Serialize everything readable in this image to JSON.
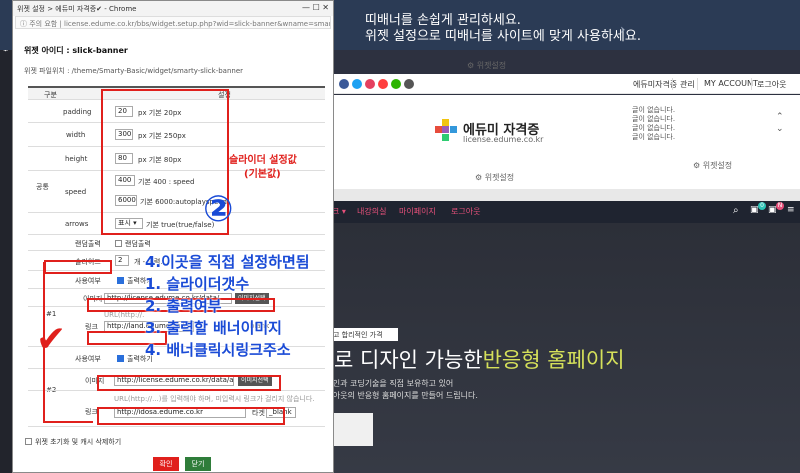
{
  "popup": {
    "window_title": "위젯 설정 > 에듀미 자격증✔ - Chrome",
    "address_warning": "주의 요함",
    "address_url": "license.edume.co.kr/bbs/widget.setup.php?wid=slick-banner&wname=smart...",
    "widget_id": "위젯 아이디 : slick-banner",
    "widget_path": "위젯 파일위치 : /theme/Smarty-Basic/widget/smarty-slick-banner",
    "table_head": {
      "col1": "구분",
      "col2": "설정"
    },
    "group_common": "공통",
    "fields": {
      "padding": {
        "label": "padding",
        "value": "20",
        "hint": "px 기본 20px"
      },
      "width": {
        "label": "width",
        "value": "300",
        "hint": "px 기본 250px"
      },
      "height": {
        "label": "height",
        "value": "80",
        "hint": "px 기본 80px"
      },
      "speed": {
        "label": "speed",
        "value1": "400",
        "hint1": "기본 400 : speed",
        "value2": "6000",
        "hint2": "기본 6000:autoplayspeed"
      },
      "arrows": {
        "label": "arrows",
        "value": "표시 ▾",
        "hint": "기본 true(true/false)"
      }
    },
    "random": {
      "label": "랜덤출력",
      "check": "랜덤출력"
    },
    "slide_count": {
      "label": "슬라이드",
      "value": "2",
      "hint": "개 - 입력..."
    },
    "item1": {
      "group": "#1",
      "use_label": "사용여부",
      "use_check": "출력하기",
      "image_label": "이미지",
      "image_value": "http://license.edume.co.kr/data/...",
      "image_btn": "이미지선택",
      "link_label": "링크",
      "link_hint": "URL(http://...)를 입력해야 하며...",
      "link_value": "http://land.edume.co.kr",
      "target": "blank"
    },
    "item2": {
      "group": "#2",
      "use_label": "사용여부",
      "use_check": "출력하기",
      "image_label": "이미지",
      "image_value": "http://license.edume.co.kr/data/amns/",
      "image_btn": "이미지선택",
      "link_label": "링크",
      "link_hint": "URL(http://...)를 입력해야 하며, 미입력시 링크가 걸리지 않습니다.",
      "link_value": "http://idosa.edume.co.kr",
      "target_label": "타겟",
      "target": "_blank"
    },
    "reset_label": "위젯 초기화 및 캐시 삭제하기",
    "ok_label": "확인",
    "close_label": "닫기"
  },
  "annotations": {
    "slider_note1": "슬라이더 설정값",
    "slider_note2": "(기본값)",
    "circle_num": "②",
    "line1": "4.이곳을 직접 설정하면됨",
    "line2": "1. 슬라이더갯수",
    "line3": "2. 출력여부",
    "line4": "3. 출력할 배너이미지",
    "line5": "4. 배너클릭시링크주소"
  },
  "site": {
    "banner_line1": "띠배너를 손쉽게 관리하세요.",
    "banner_line2": "위젯 설정으로 띠배너를 사이트에 맞게 사용하세요.",
    "banner_arrow": "›",
    "widget_setting1": "⚙ 위젯설정",
    "top_links": [
      "에듀미자격증",
      "관리",
      "MY ACCOUNT",
      "로그아웃"
    ],
    "logo_title": "에듀미 자격증",
    "logo_sub": "license.edume.co.kr",
    "notices": [
      "글이 없습니다.",
      "글이 없습니다.",
      "글이 없습니다.",
      "글이 없습니다."
    ],
    "notice_up": "⌃",
    "notice_down": "⌄",
    "widget_setting2": "⚙ 위젯설정",
    "widget_setting3": "⚙ 위젯설정",
    "nav": [
      "크 ▾",
      "내강의실",
      "마이페이지",
      "로그아웃"
    ],
    "nav_badge1": "0",
    "nav_badge2": "N",
    "hero_badge": "고 합리적인 가격",
    "hero_title_a": "로 디자인 가능한",
    "hero_title_b": "반응형 홈페이지",
    "hero_p1": "디자인과 코딩기술을 직접 보유하고 있어",
    "hero_p2": "레이아웃의 반응형 홈페이지를 만들어 드립니다."
  },
  "colors": {
    "red": "#e0201c",
    "blue": "#1a4bd6",
    "banner_bg": "#2b3b55",
    "nav_pink": "#e6507a",
    "ok": "#e0201c",
    "close": "#2f7d3a"
  }
}
